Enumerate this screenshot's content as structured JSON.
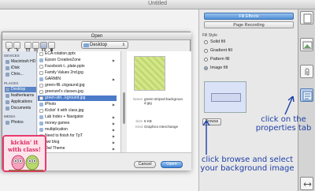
{
  "background": {
    "window_title": "Untitled"
  },
  "panel": {
    "fill_effects_label": "Fill Effects",
    "page_recording_label": "Page Recording",
    "fill_style_label": "Fill Style",
    "options": [
      {
        "label": "Solid fill",
        "selected": false
      },
      {
        "label": "Gradient fill",
        "selected": false
      },
      {
        "label": "Pattern fill",
        "selected": false
      },
      {
        "label": "Image fill",
        "selected": true
      }
    ],
    "browse_label": "Browse"
  },
  "dialog": {
    "title": "Open",
    "location": "Desktop",
    "sidebar": {
      "devices_header": "DEVICES",
      "devices": [
        "Macintosh HD",
        "iDisk",
        "Chris..."
      ],
      "places_header": "PLACES",
      "places": [
        "Desktop",
        "featherlearns",
        "Applications",
        "Documents"
      ],
      "media_header": "MEDIA",
      "media": [
        "Photos"
      ]
    },
    "files": [
      {
        "name": "ECA rotation.pptx",
        "kind": "file"
      },
      {
        "name": "Epson CreativeZone",
        "kind": "folder"
      },
      {
        "name": "Facebook t...plate.pptx",
        "kind": "file"
      },
      {
        "name": "Family Values 2nd.jpg",
        "kind": "file"
      },
      {
        "name": "GARMIN",
        "kind": "folder"
      },
      {
        "name": "green-fill..ckgraund.jpg",
        "kind": "file"
      },
      {
        "name": "greenzel's classes.jpg",
        "kind": "file"
      },
      {
        "name": "green-stri...kground.jpg",
        "kind": "file",
        "selected": true
      },
      {
        "name": "iPhoto",
        "kind": "folder"
      },
      {
        "name": "Kickin' it with class.jpg",
        "kind": "file"
      },
      {
        "name": "Lab Index + Navigator",
        "kind": "folder"
      },
      {
        "name": "money games",
        "kind": "folder"
      },
      {
        "name": "multiplication",
        "kind": "folder"
      },
      {
        "name": "Need to finish for TpT",
        "kind": "folder"
      },
      {
        "name": "owl blog",
        "kind": "folder"
      },
      {
        "name": "Owl Theme",
        "kind": "folder"
      }
    ],
    "preview": {
      "name_key": "Name",
      "name_val": "green-striped-background.jpg",
      "size_key": "Size",
      "size_val": "8 KB",
      "kind_key": "Kind",
      "kind_val": "Graphics Interchange"
    },
    "cancel_label": "Cancel",
    "open_label": "Open"
  },
  "annotations": {
    "properties_note": "click on the properties tab",
    "browse_note": "click browse and select your background image"
  },
  "logo": {
    "line1": "kickin' it",
    "line2": "with class!"
  },
  "colors": {
    "accent_blue": "#4b7bc8",
    "annotation_blue": "#1d3fa6",
    "logo_pink": "#e63b6e",
    "preview_green": "#c1d86e"
  }
}
